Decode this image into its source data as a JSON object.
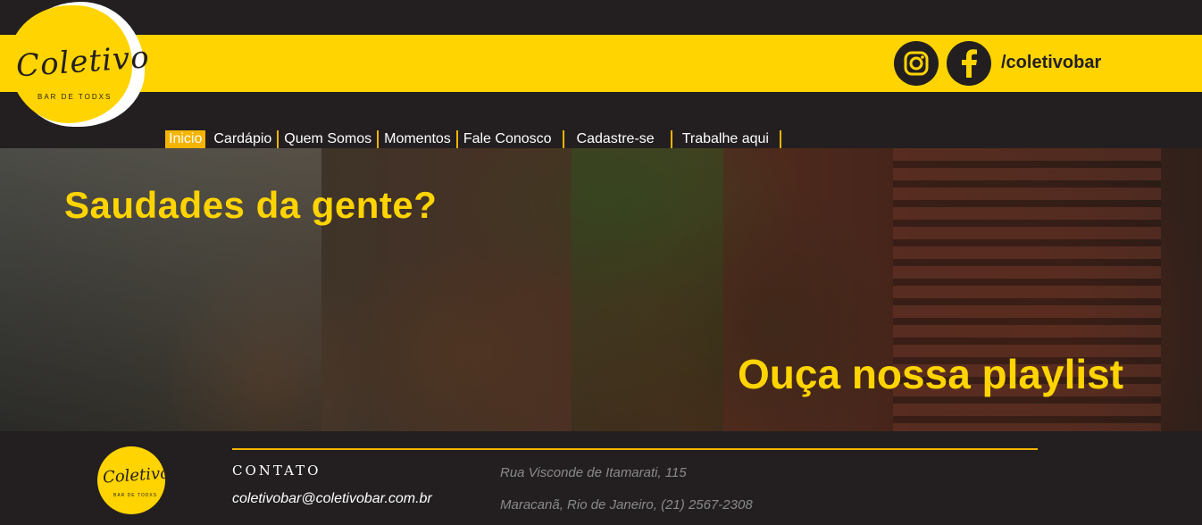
{
  "brand": {
    "logo_text": "Coletivo",
    "logo_subtitle": "BAR DE TODXS",
    "colors": {
      "yellow": "#ffd400",
      "accent": "#f5b400",
      "dark": "#231f20"
    }
  },
  "social": {
    "icons": [
      "instagram-icon",
      "facebook-icon"
    ],
    "handle": "/coletivobar"
  },
  "nav": {
    "items": [
      {
        "label": "Inicio",
        "active": true
      },
      {
        "label": "Cardápio"
      },
      {
        "label": "Quem Somos"
      },
      {
        "label": "Momentos"
      },
      {
        "label": "Fale Conosco"
      },
      {
        "label": "Cadastre-se"
      },
      {
        "label": "Trabalhe aqui"
      }
    ]
  },
  "hero": {
    "headline": "Saudades da gente?",
    "cta": "Ouça nossa playlist"
  },
  "footer": {
    "logo_text": "Coletivo",
    "logo_subtitle": "BAR DE TODXS",
    "contact_title": "CONTATO",
    "email": "coletivobar@coletivobar.com.br",
    "address_line1": "Rua Visconde de Itamarati, 115",
    "address_line2": "Maracanã, Rio de Janeiro, (21) 2567-2308"
  }
}
